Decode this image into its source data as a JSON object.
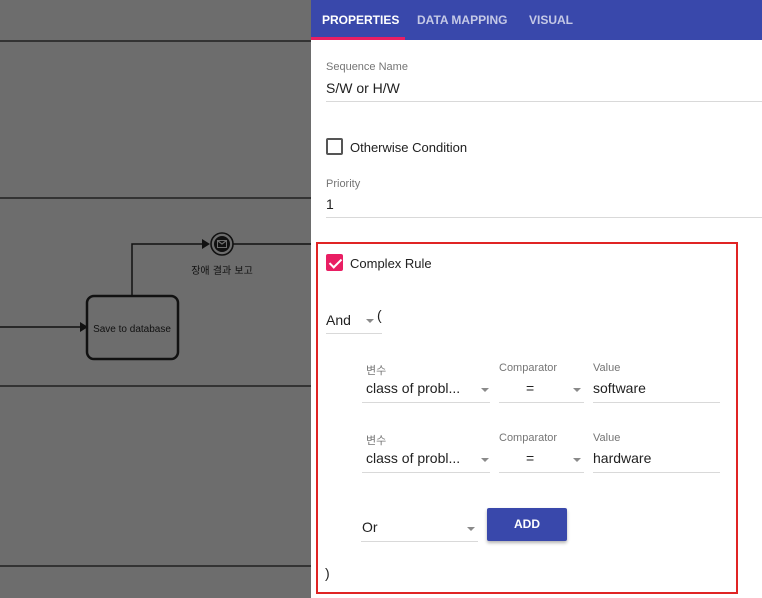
{
  "colors": {
    "canvas": "#6d6d6d",
    "tabbar": "#3948ab",
    "accent": "#e91e63",
    "highlight": "#e02424"
  },
  "canvas": {
    "task_label": "Save to database",
    "event_label": "장애 결과 보고",
    "event_icon": "envelope-icon"
  },
  "tabs": [
    {
      "label": "PROPERTIES",
      "active": true
    },
    {
      "label": "DATA MAPPING",
      "active": false
    },
    {
      "label": "VISUAL",
      "active": false
    }
  ],
  "sequence_name": {
    "label": "Sequence Name",
    "value": "S/W or H/W"
  },
  "otherwise": {
    "label": "Otherwise Condition",
    "checked": false
  },
  "priority": {
    "label": "Priority",
    "value": "1"
  },
  "complex_rule": {
    "label": "Complex Rule",
    "checked": true,
    "operator": "And",
    "open_paren": "(",
    "close_paren": ")",
    "rows": [
      {
        "var_label": "변수",
        "var_value": "class of probl...",
        "cmp_label": "Comparator",
        "cmp_value": "=",
        "val_label": "Value",
        "val_value": "software"
      },
      {
        "var_label": "변수",
        "var_value": "class of probl...",
        "cmp_label": "Comparator",
        "cmp_value": "=",
        "val_label": "Value",
        "val_value": "hardware"
      }
    ],
    "add_operator": "Or",
    "add_label": "ADD"
  }
}
